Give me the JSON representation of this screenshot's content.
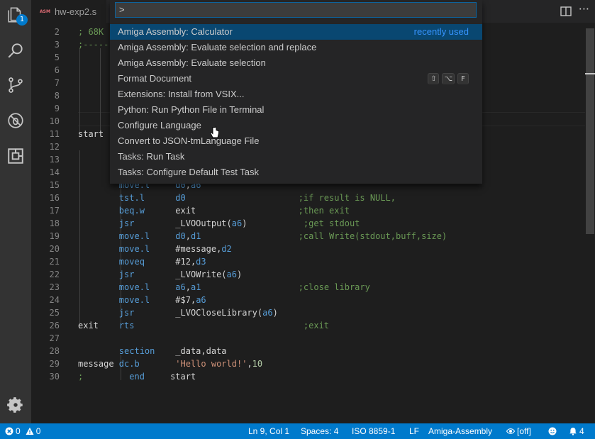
{
  "tab": {
    "icon_text": "ASM",
    "label": "hw-exp2.s"
  },
  "activity": {
    "explorer_badge": "1",
    "icons": [
      "files-icon",
      "search-icon",
      "source-control-icon",
      "debug-icon",
      "extensions-icon",
      "settings-gear-icon"
    ]
  },
  "palette": {
    "input_value": ">",
    "items": [
      {
        "label": "Amiga Assembly: Calculator",
        "hint": "recently used"
      },
      {
        "label": "Amiga Assembly: Evaluate selection and replace"
      },
      {
        "label": "Amiga Assembly: Evaluate selection"
      },
      {
        "label": "Format Document",
        "keys": [
          "⇧",
          "⌥",
          "F"
        ]
      },
      {
        "label": "Extensions: Install from VSIX..."
      },
      {
        "label": "Python: Run Python File in Terminal"
      },
      {
        "label": "Configure Language"
      },
      {
        "label": "Convert to JSON-tmLanguage File"
      },
      {
        "label": "Tasks: Run Task"
      },
      {
        "label": "Tasks: Configure Default Test Task"
      }
    ]
  },
  "editor": {
    "lines": [
      {
        "n": "2",
        "tokens": [
          [
            "cmt",
            "; 68K"
          ]
        ]
      },
      {
        "n": "3",
        "tokens": [
          [
            "cmt",
            ";-----"
          ]
        ]
      },
      {
        "n": "5",
        "tokens": []
      },
      {
        "n": "6",
        "tokens": []
      },
      {
        "n": "7",
        "tokens": []
      },
      {
        "n": "8",
        "tokens": []
      },
      {
        "n": "9",
        "tokens": []
      },
      {
        "n": "10",
        "tokens": []
      },
      {
        "n": "11",
        "tokens": [
          [
            "plain",
            "start"
          ]
        ]
      },
      {
        "n": "12",
        "tokens": []
      },
      {
        "n": "13",
        "tokens": []
      },
      {
        "n": "14",
        "tokens": []
      },
      {
        "n": "15",
        "tokens": [
          [
            "plain",
            "        "
          ],
          [
            "kw",
            "move.l"
          ],
          [
            "plain",
            "     "
          ],
          [
            "reg",
            "d0"
          ],
          [
            "plain",
            ","
          ],
          [
            "reg",
            "a6"
          ]
        ]
      },
      {
        "n": "16",
        "tokens": [
          [
            "plain",
            "        "
          ],
          [
            "kw",
            "tst.l"
          ],
          [
            "plain",
            "      "
          ],
          [
            "reg",
            "d0"
          ],
          [
            "plain",
            "                      "
          ],
          [
            "cmt",
            ";if result is NULL,"
          ]
        ]
      },
      {
        "n": "17",
        "tokens": [
          [
            "plain",
            "        "
          ],
          [
            "kw",
            "beq.w"
          ],
          [
            "plain",
            "      exit                    "
          ],
          [
            "cmt",
            ";then exit"
          ]
        ]
      },
      {
        "n": "18",
        "tokens": [
          [
            "plain",
            "        "
          ],
          [
            "kw",
            "jsr"
          ],
          [
            "plain",
            "        _LVOOutput("
          ],
          [
            "reg",
            "a6"
          ],
          [
            "plain",
            ")           "
          ],
          [
            "cmt",
            ";get stdout"
          ]
        ]
      },
      {
        "n": "19",
        "tokens": [
          [
            "plain",
            "        "
          ],
          [
            "kw",
            "move.l"
          ],
          [
            "plain",
            "     "
          ],
          [
            "reg",
            "d0"
          ],
          [
            "plain",
            ","
          ],
          [
            "reg",
            "d1"
          ],
          [
            "plain",
            "                   "
          ],
          [
            "cmt",
            ";call Write(stdout,buff,size)"
          ]
        ]
      },
      {
        "n": "20",
        "tokens": [
          [
            "plain",
            "        "
          ],
          [
            "kw",
            "move.l"
          ],
          [
            "plain",
            "     #message,"
          ],
          [
            "reg",
            "d2"
          ]
        ]
      },
      {
        "n": "21",
        "tokens": [
          [
            "plain",
            "        "
          ],
          [
            "kw",
            "moveq"
          ],
          [
            "plain",
            "      #12,"
          ],
          [
            "reg",
            "d3"
          ]
        ]
      },
      {
        "n": "22",
        "tokens": [
          [
            "plain",
            "        "
          ],
          [
            "kw",
            "jsr"
          ],
          [
            "plain",
            "        _LVOWrite("
          ],
          [
            "reg",
            "a6"
          ],
          [
            "plain",
            ")"
          ]
        ]
      },
      {
        "n": "23",
        "tokens": [
          [
            "plain",
            "        "
          ],
          [
            "kw",
            "move.l"
          ],
          [
            "plain",
            "     "
          ],
          [
            "reg",
            "a6"
          ],
          [
            "plain",
            ","
          ],
          [
            "reg",
            "a1"
          ],
          [
            "plain",
            "                   "
          ],
          [
            "cmt",
            ";close library"
          ]
        ]
      },
      {
        "n": "24",
        "tokens": [
          [
            "plain",
            "        "
          ],
          [
            "kw",
            "move.l"
          ],
          [
            "plain",
            "     #$7,"
          ],
          [
            "reg",
            "a6"
          ]
        ]
      },
      {
        "n": "25",
        "tokens": [
          [
            "plain",
            "        "
          ],
          [
            "kw",
            "jsr"
          ],
          [
            "plain",
            "        _LVOCloseLibrary("
          ],
          [
            "reg",
            "a6"
          ],
          [
            "plain",
            ")"
          ]
        ]
      },
      {
        "n": "26",
        "tokens": [
          [
            "plain",
            "exit    "
          ],
          [
            "kw",
            "rts"
          ],
          [
            "plain",
            "                                 "
          ],
          [
            "cmt",
            ";exit"
          ]
        ]
      },
      {
        "n": "27",
        "tokens": []
      },
      {
        "n": "28",
        "tokens": [
          [
            "plain",
            "        "
          ],
          [
            "kw",
            "section"
          ],
          [
            "plain",
            "    _data,data"
          ]
        ]
      },
      {
        "n": "29",
        "tokens": [
          [
            "plain",
            "message "
          ],
          [
            "kw",
            "dc.b"
          ],
          [
            "plain",
            "       "
          ],
          [
            "str",
            "'Hello world!'"
          ],
          [
            "plain",
            ","
          ],
          [
            "num",
            "10"
          ]
        ]
      },
      {
        "n": "30",
        "tokens": [
          [
            "cmt",
            ";"
          ],
          [
            "plain",
            "         "
          ],
          [
            "kw",
            "end"
          ],
          [
            "plain",
            "     start"
          ]
        ]
      }
    ]
  },
  "status": {
    "errors": "0",
    "warnings": "0",
    "position": "Ln 9, Col 1",
    "spaces": "Spaces: 4",
    "encoding": "ISO 8859-1",
    "eol": "LF",
    "language": "Amiga-Assembly",
    "eye_state": "[off]",
    "notifications": "4"
  },
  "colors": {
    "accent": "#007acc",
    "selection": "#094771",
    "keyword": "#569cd6",
    "comment": "#6a9955",
    "string": "#ce9178",
    "number": "#b5cea8"
  }
}
